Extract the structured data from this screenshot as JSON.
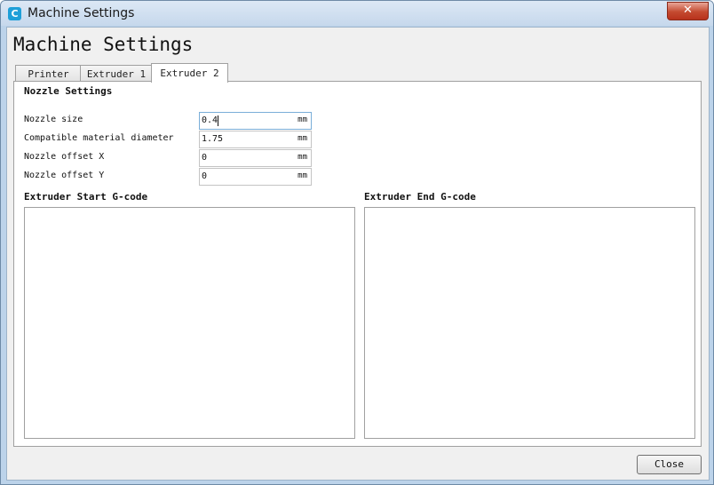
{
  "window": {
    "title": "Machine Settings",
    "app_icon": "C",
    "close_glyph": "✕"
  },
  "page_title": "Machine Settings",
  "tabs": [
    {
      "label": "Printer",
      "active": false
    },
    {
      "label": "Extruder 1",
      "active": false
    },
    {
      "label": "Extruder 2",
      "active": true
    }
  ],
  "nozzle": {
    "section_title": "Nozzle Settings",
    "fields": [
      {
        "label": "Nozzle size",
        "value": "0.4",
        "unit": "mm"
      },
      {
        "label": "Compatible material diameter",
        "value": "1.75",
        "unit": "mm"
      },
      {
        "label": "Nozzle offset X",
        "value": "0",
        "unit": "mm"
      },
      {
        "label": "Nozzle offset Y",
        "value": "0",
        "unit": "mm"
      }
    ]
  },
  "gcode": {
    "start_title": "Extruder Start G-code",
    "end_title": "Extruder End G-code",
    "start_value": "",
    "end_value": ""
  },
  "footer": {
    "close_label": "Close"
  },
  "colors": {
    "app_icon": "#1e9fd8",
    "close_x": "#c44a30",
    "focus_border": "#7aaed8"
  }
}
